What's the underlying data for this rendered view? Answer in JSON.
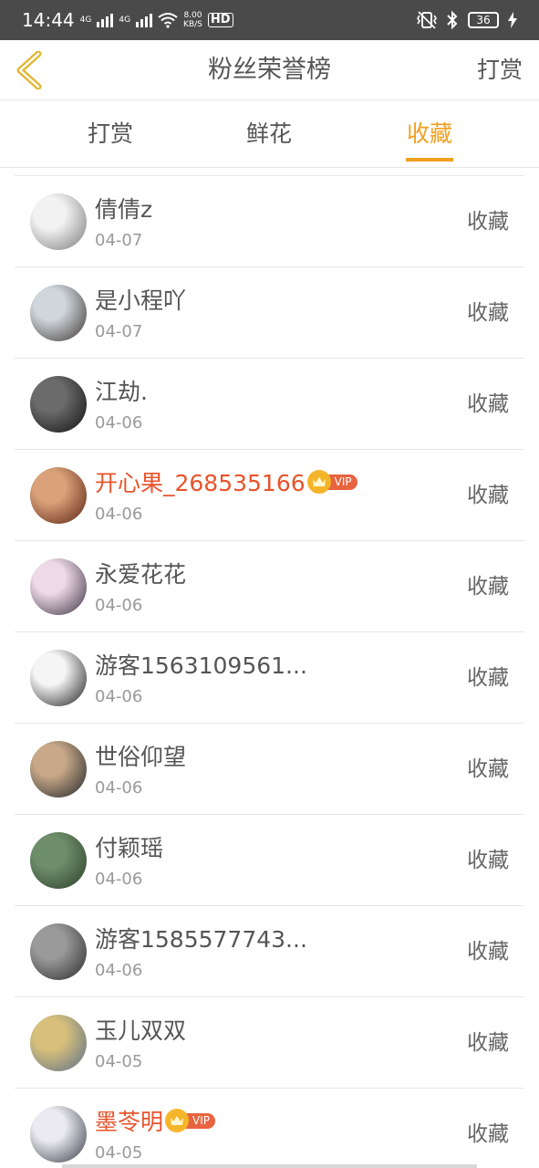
{
  "status_bar": {
    "time": "14:44",
    "net_a": "4G",
    "net_b": "4G",
    "speed_value": "8.00",
    "speed_unit": "KB/S",
    "hd": "HD",
    "battery": "36"
  },
  "header": {
    "title": "粉丝荣誉榜",
    "action_label": "打赏"
  },
  "tabs": [
    {
      "label": "打赏",
      "active": false
    },
    {
      "label": "鲜花",
      "active": false
    },
    {
      "label": "收藏",
      "active": true
    }
  ],
  "vip_tag_text": "VIP",
  "rows": [
    {
      "name": "倩倩z",
      "date": "04-07",
      "action": "收藏",
      "vip": false,
      "avatar_colors": [
        "#f2f2f2",
        "#7a7a7a"
      ]
    },
    {
      "name": "是小程吖",
      "date": "04-07",
      "action": "收藏",
      "vip": false,
      "avatar_colors": [
        "#cfd6dc",
        "#3d3530"
      ]
    },
    {
      "name": "江劫.",
      "date": "04-06",
      "action": "收藏",
      "vip": false,
      "avatar_colors": [
        "#6b6b6b",
        "#111111"
      ]
    },
    {
      "name": "开心果_268535166",
      "date": "04-06",
      "action": "收藏",
      "vip": true,
      "avatar_colors": [
        "#d9a27a",
        "#5a2010"
      ]
    },
    {
      "name": "永爱花花",
      "date": "04-06",
      "action": "收藏",
      "vip": false,
      "avatar_colors": [
        "#eed9e6",
        "#3a3040"
      ]
    },
    {
      "name": "游客1563109561...",
      "date": "04-06",
      "action": "收藏",
      "vip": false,
      "avatar_colors": [
        "#f5f5f5",
        "#1c1c1c"
      ]
    },
    {
      "name": "世俗仰望",
      "date": "04-06",
      "action": "收藏",
      "vip": false,
      "avatar_colors": [
        "#c8a888",
        "#1e2428"
      ]
    },
    {
      "name": "付颖瑶",
      "date": "04-06",
      "action": "收藏",
      "vip": false,
      "avatar_colors": [
        "#6e8e6a",
        "#2c3e2a"
      ]
    },
    {
      "name": "游客1585577743...",
      "date": "04-06",
      "action": "收藏",
      "vip": false,
      "avatar_colors": [
        "#9a9a9a",
        "#2a2a2a"
      ]
    },
    {
      "name": "玉儿双双",
      "date": "04-05",
      "action": "收藏",
      "vip": false,
      "avatar_colors": [
        "#d8c07a",
        "#5a6e8a"
      ]
    },
    {
      "name": "墨苓明",
      "date": "04-05",
      "action": "收藏",
      "vip": true,
      "avatar_colors": [
        "#eaeaf0",
        "#3a3a48"
      ]
    }
  ],
  "colors": {
    "accent": "#f0a020",
    "vip_name": "#e8542c"
  }
}
